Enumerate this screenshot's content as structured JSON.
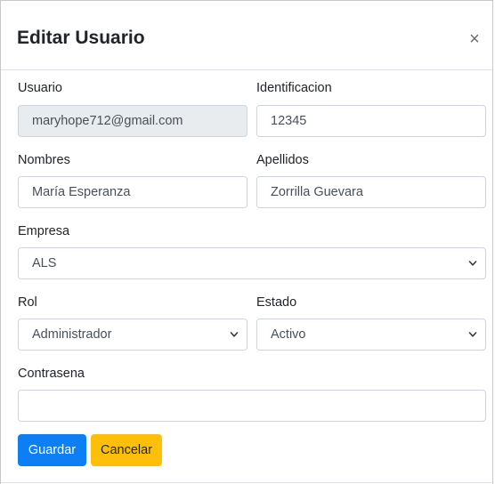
{
  "modal": {
    "title": "Editar Usuario",
    "close_symbol": "×"
  },
  "form": {
    "usuario": {
      "label": "Usuario",
      "value": "maryhope712@gmail.com"
    },
    "identificacion": {
      "label": "Identificacion",
      "value": "12345"
    },
    "nombres": {
      "label": "Nombres",
      "value": "María Esperanza"
    },
    "apellidos": {
      "label": "Apellidos",
      "value": "Zorrilla Guevara"
    },
    "empresa": {
      "label": "Empresa",
      "value": "ALS"
    },
    "rol": {
      "label": "Rol",
      "value": "Administrador"
    },
    "estado": {
      "label": "Estado",
      "value": "Activo"
    },
    "contrasena": {
      "label": "Contrasena",
      "value": ""
    }
  },
  "buttons": {
    "save_label": "Guardar",
    "cancel_label": "Cancelar"
  },
  "colors": {
    "primary": "#0d7ff5",
    "warning": "#fdbf09",
    "disabled_bg": "#e9ecef",
    "border": "#ced4da"
  },
  "icons": {
    "close": "close-icon",
    "select": "chevron-down-icon"
  }
}
